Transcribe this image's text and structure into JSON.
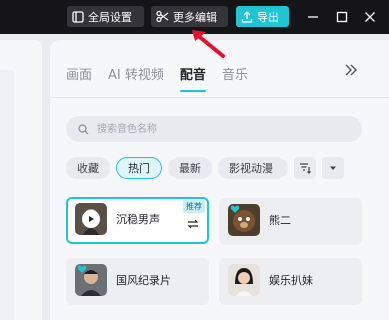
{
  "toolbar": {
    "global_settings_label": "全局设置",
    "more_edit_label": "更多编辑",
    "export_label": "导出"
  },
  "tabs": [
    {
      "label": "画面"
    },
    {
      "label": "AI 转视频"
    },
    {
      "label": "配音",
      "active": true
    },
    {
      "label": "音乐"
    }
  ],
  "search": {
    "placeholder": "搜索音色名称"
  },
  "filters": [
    {
      "label": "收藏"
    },
    {
      "label": "热门",
      "active": true
    },
    {
      "label": "最新"
    },
    {
      "label": "影视动漫"
    }
  ],
  "voices": [
    {
      "name": "沉稳男声",
      "badge": "推荐",
      "selected": true
    },
    {
      "name": "熊二"
    },
    {
      "name": "国风纪录片"
    },
    {
      "name": "娱乐扒妹"
    }
  ],
  "colors": {
    "accent": "#21c4d3",
    "topbar": "#151517",
    "annotation_arrow": "#e8102e"
  }
}
